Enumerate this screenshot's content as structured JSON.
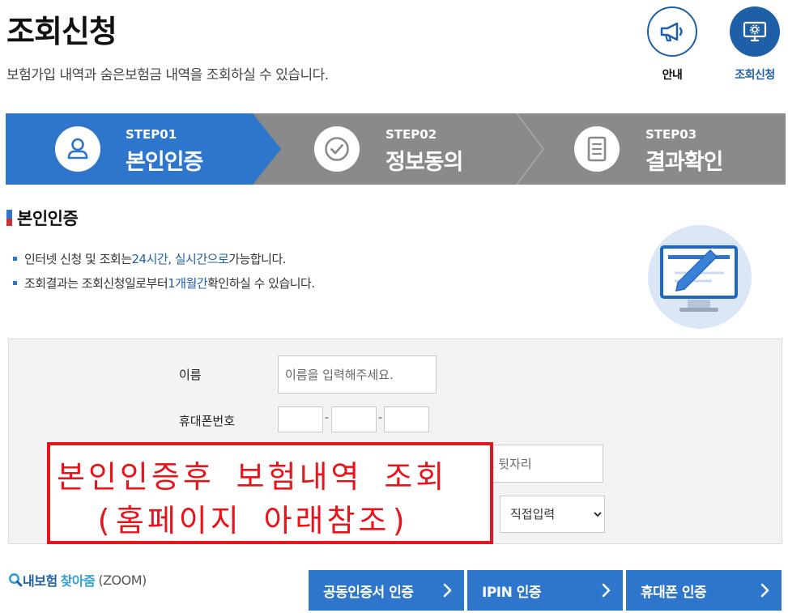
{
  "header": {
    "title": "조회신청",
    "description": "보험가입 내역과 숨은보험금 내역을 조회하실 수 있습니다.",
    "guide_label": "안내",
    "apply_label": "조회신청"
  },
  "steps": [
    {
      "num": "STEP01",
      "name": "본인인증",
      "icon": "user-icon",
      "active": true
    },
    {
      "num": "STEP02",
      "name": "정보동의",
      "icon": "check-circle-icon",
      "active": false
    },
    {
      "num": "STEP03",
      "name": "결과확인",
      "icon": "document-icon",
      "active": false
    }
  ],
  "section": {
    "title": "본인인증",
    "notes": [
      {
        "pre": "인터넷 신청 및 조회는 ",
        "hl": "24시간, 실시간으로",
        "post": " 가능합니다."
      },
      {
        "pre": "조회결과는 조회신청일로부터 ",
        "hl": "1개월간",
        "post": " 확인하실 수 있습니다."
      }
    ]
  },
  "form": {
    "name_label": "이름",
    "name_placeholder": "이름을 입력해주세요.",
    "phone_label": "휴대폰번호",
    "phone_sep": "-",
    "regno_partial_placeholder": "록번호 뒷자리",
    "method_options": [
      "직접입력"
    ]
  },
  "overlay": {
    "line1": "본인인증후 보험내역 조회",
    "line2": "(홈페이지 아래참조)"
  },
  "bottom": {
    "zoom_part1": "내보험",
    "zoom_part2": "찾아줌",
    "zoom_part3": "(ZOOM)",
    "auth_buttons": [
      "공동인증서 인증",
      "IPIN 인증",
      "휴대폰 인증"
    ]
  },
  "colors": {
    "primary": "#2e76cc",
    "dark_blue": "#1f5fa8",
    "step_inactive": "#8a8a8a",
    "annotation_red": "#e8141c"
  }
}
